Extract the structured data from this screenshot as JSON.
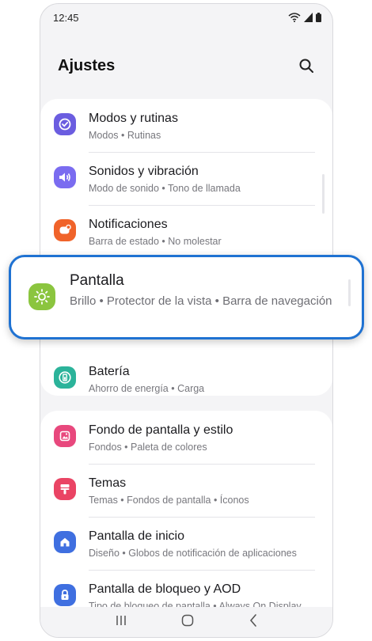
{
  "status_bar": {
    "time": "12:45"
  },
  "header": {
    "title": "Ajustes"
  },
  "group_a": [
    {
      "title": "Modos y rutinas",
      "subtitle": "Modos • Rutinas",
      "icon": "modes-routines-icon",
      "color": "#6b5de0"
    },
    {
      "title": "Sonidos y vibración",
      "subtitle": "Modo de sonido • Tono de llamada",
      "icon": "sound-icon",
      "color": "#7a6cf0"
    },
    {
      "title": "Notificaciones",
      "subtitle": "Barra de estado • No molestar",
      "icon": "notifications-icon",
      "color": "#f0632a"
    },
    {
      "title": "Batería",
      "subtitle": "Ahorro de energía • Carga",
      "icon": "battery-icon",
      "color": "#2bb39a"
    }
  ],
  "highlight": {
    "title": "Pantalla",
    "subtitle": "Brillo • Protector de la vista • Barra de navegación",
    "icon": "display-brightness-icon",
    "color": "#8bc53f"
  },
  "group_b": [
    {
      "title": "Fondo de pantalla y estilo",
      "subtitle": "Fondos • Paleta de colores",
      "icon": "wallpaper-icon",
      "color": "#e8487d"
    },
    {
      "title": "Temas",
      "subtitle": "Temas • Fondos de pantalla • Íconos",
      "icon": "themes-icon",
      "color": "#ea4464"
    },
    {
      "title": "Pantalla de inicio",
      "subtitle": "Diseño • Globos de notificación de aplicaciones",
      "icon": "home-screen-icon",
      "color": "#3f6fe0"
    },
    {
      "title": "Pantalla de bloqueo y AOD",
      "subtitle": "Tipo de bloqueo de pantalla • Always On Display",
      "icon": "lock-screen-icon",
      "color": "#3f6fe0"
    }
  ],
  "nav_bar": {
    "items": [
      "recent-apps",
      "home",
      "back"
    ]
  }
}
